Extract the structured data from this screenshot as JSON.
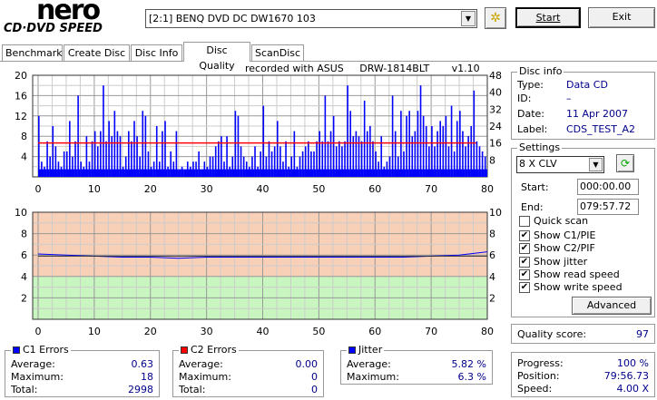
{
  "app": {
    "logo_top": "nero",
    "logo_bottom": "CD·DVD SPEED"
  },
  "toolbar": {
    "drive": "[2:1]  BENQ DVD DC DW1670 103",
    "start_label": "Start",
    "exit_label": "Exit",
    "settings_icon": "tools-icon"
  },
  "tabs": [
    {
      "label": "Benchmark"
    },
    {
      "label": "Create Disc"
    },
    {
      "label": "Disc Info"
    },
    {
      "label": "Disc Quality",
      "active": true
    },
    {
      "label": "ScanDisc"
    }
  ],
  "recorded_with": "recorded with ASUS     DRW-1814BLT       v1.10",
  "disc_info": {
    "title": "Disc info",
    "type_label": "Type:",
    "type": "Data CD",
    "id_label": "ID:",
    "id": "–",
    "date_label": "Date:",
    "date": "11 Apr 2007",
    "label_label": "Label:",
    "label": "CDS_TEST_A2"
  },
  "settings": {
    "title": "Settings",
    "speed": "8 X CLV",
    "start_label": "Start:",
    "start": "000:00.00",
    "end_label": "End:",
    "end": "079:57.72",
    "checks": [
      {
        "label": "Quick scan",
        "checked": false
      },
      {
        "label": "Show C1/PIE",
        "checked": true
      },
      {
        "label": "Show C2/PIF",
        "checked": true
      },
      {
        "label": "Show jitter",
        "checked": true
      },
      {
        "label": "Show read speed",
        "checked": true
      },
      {
        "label": "Show write speed",
        "checked": true
      }
    ],
    "advanced_label": "Advanced"
  },
  "quality": {
    "label": "Quality score:",
    "value": "97"
  },
  "progress": {
    "progress_label": "Progress:",
    "progress": "100 %",
    "position_label": "Position:",
    "position": "79:56.73",
    "speed_label": "Speed:",
    "speed": "4.00 X"
  },
  "c1": {
    "title": "C1 Errors",
    "color": "#0000ff",
    "avg_label": "Average:",
    "avg": "0.63",
    "max_label": "Maximum:",
    "max": "18",
    "total_label": "Total:",
    "total": "2998"
  },
  "c2": {
    "title": "C2 Errors",
    "color": "#ff0000",
    "avg_label": "Average:",
    "avg": "0.00",
    "max_label": "Maximum:",
    "max": "0",
    "total_label": "Total:",
    "total": "0"
  },
  "jitter": {
    "title": "Jitter",
    "color": "#0000ff",
    "avg_label": "Average:",
    "avg": "5.82 %",
    "max_label": "Maximum:",
    "max": "6.3 %"
  },
  "chart_data": [
    {
      "type": "bar",
      "name": "C1 errors",
      "xlim": [
        0,
        80
      ],
      "ylim": [
        0,
        20
      ],
      "y2lim": [
        0,
        48
      ],
      "xticks": [
        "0",
        "10",
        "20",
        "30",
        "40",
        "50",
        "60",
        "70",
        "80"
      ],
      "yticks": [
        "4",
        "8",
        "12",
        "16",
        "20"
      ],
      "y2ticks": [
        "8",
        "16",
        "24",
        "32",
        "40",
        "48"
      ],
      "x_step": 0.5,
      "values": [
        12,
        3,
        2,
        7,
        4,
        10,
        6,
        3,
        2,
        5,
        5,
        11,
        4,
        7,
        16,
        3,
        2,
        8,
        3,
        7,
        9,
        6,
        9,
        18,
        7,
        11,
        8,
        13,
        9,
        8,
        2,
        4,
        9,
        7,
        11,
        8,
        4,
        13,
        12,
        5,
        2,
        3,
        10,
        3,
        9,
        11,
        2,
        5,
        3,
        9,
        1,
        2,
        1,
        3,
        2,
        3,
        3,
        5,
        1,
        3,
        2,
        4,
        4,
        6,
        7,
        8,
        3,
        8,
        2,
        4,
        13,
        12,
        6,
        4,
        3,
        2,
        4,
        6,
        2,
        5,
        14,
        4,
        7,
        5,
        6,
        11,
        6,
        3,
        7,
        2,
        4,
        9,
        2,
        4,
        5,
        6,
        7,
        5,
        5,
        7,
        9,
        7,
        16,
        7,
        9,
        12,
        6,
        7,
        6,
        7,
        18,
        13,
        8,
        9,
        8,
        7,
        15,
        9,
        10,
        7,
        5,
        3,
        8,
        2,
        3,
        4,
        16,
        9,
        4,
        13,
        5,
        12,
        13,
        8,
        9,
        13,
        18,
        12,
        10,
        6,
        10,
        6,
        9,
        11,
        10,
        12,
        6,
        14,
        5,
        11,
        13,
        9,
        6,
        8,
        10,
        17,
        7,
        6,
        5,
        4
      ],
      "read_speed": {
        "color": "#ff0000",
        "x": [
          0,
          78
        ],
        "y2": [
          16,
          16
        ]
      }
    },
    {
      "type": "line",
      "name": "Jitter",
      "xlim": [
        0,
        80
      ],
      "ylim": [
        0,
        10
      ],
      "xticks": [
        "0",
        "10",
        "20",
        "30",
        "40",
        "50",
        "60",
        "70",
        "80"
      ],
      "yticks": [
        "2",
        "4",
        "6",
        "8",
        "10"
      ],
      "x": [
        0,
        5,
        10,
        15,
        20,
        25,
        30,
        35,
        40,
        45,
        50,
        55,
        60,
        65,
        70,
        75,
        80
      ],
      "values": [
        6.1,
        6.0,
        5.9,
        5.8,
        5.8,
        5.7,
        5.8,
        5.8,
        5.8,
        5.8,
        5.8,
        5.8,
        5.8,
        5.8,
        5.9,
        6.0,
        6.3
      ],
      "zones": [
        {
          "from": 0,
          "to": 4,
          "color": "#c8f5c0"
        },
        {
          "from": 4,
          "to": 10,
          "color": "#f8d0b8"
        }
      ]
    }
  ]
}
